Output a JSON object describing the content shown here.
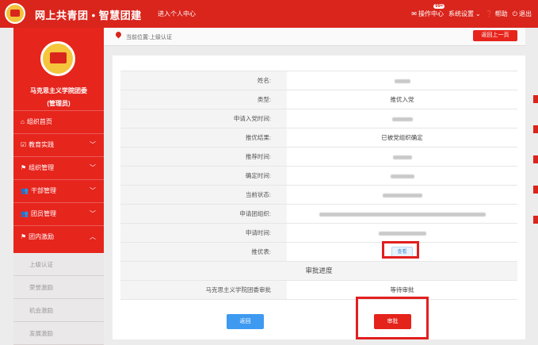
{
  "header": {
    "title": "网上共青团 • 智慧团建",
    "personal_center": "进入个人中心",
    "ops_label": "操作中心",
    "ops_badge": "99+",
    "settings_label": "系统设置",
    "help_label": "帮助",
    "logout_label": "退出"
  },
  "sidebar": {
    "org_name": "马克思主义学院团委",
    "role": "(管理员)",
    "items": [
      {
        "label": "组织首页",
        "icon": "home-icon"
      },
      {
        "label": "教育实践",
        "icon": "check-icon"
      },
      {
        "label": "组织管理",
        "icon": "org-icon"
      },
      {
        "label": "干部管理",
        "icon": "users-icon"
      },
      {
        "label": "团员管理",
        "icon": "users-icon"
      },
      {
        "label": "团内激励",
        "icon": "org-icon"
      }
    ],
    "subitems": [
      "上级认证",
      "荣誉激励",
      "机会激励",
      "发展激励"
    ]
  },
  "breadcrumb": {
    "text": "当前位置:上级认证",
    "back_label": "返回上一页"
  },
  "detail": {
    "rows": [
      {
        "label": "姓名:",
        "value": ""
      },
      {
        "label": "类型:",
        "value": "推优入党"
      },
      {
        "label": "申请入党时间:",
        "value": ""
      },
      {
        "label": "推优结果:",
        "value": "已被党组织确定"
      },
      {
        "label": "推荐时间:",
        "value": ""
      },
      {
        "label": "确定时间:",
        "value": ""
      },
      {
        "label": "当前状态:",
        "value": ""
      },
      {
        "label": "申请团组织:",
        "value": ""
      },
      {
        "label": "申请时间:",
        "value": ""
      },
      {
        "label": "推优表:",
        "value": ""
      }
    ],
    "view_label": "查看",
    "progress_title": "审批进度",
    "progress_org": "马克思主义学院团委审批",
    "progress_status": "等待审批"
  },
  "actions": {
    "return_label": "返回",
    "approve_label": "审批"
  },
  "colors": {
    "brand_red": "#d9251c",
    "button_blue": "#3e9af0"
  }
}
